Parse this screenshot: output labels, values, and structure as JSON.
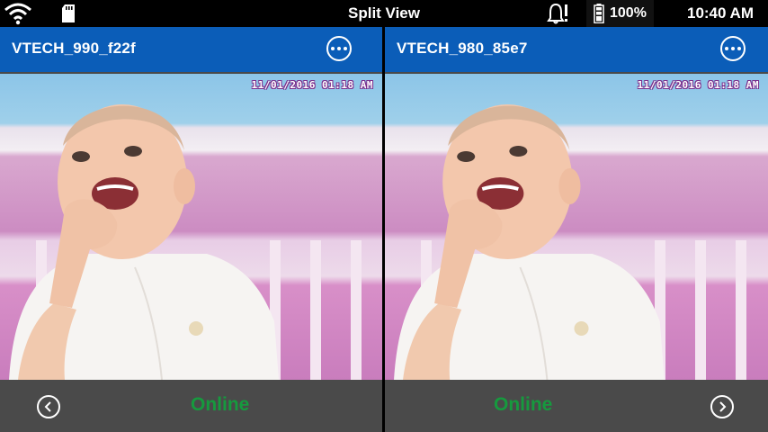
{
  "status_bar": {
    "title": "Split View",
    "battery": "100%",
    "time": "10:40 AM",
    "icons": [
      "wifi-icon",
      "sd-card-icon",
      "alert-bell-icon",
      "battery-icon"
    ]
  },
  "panes": [
    {
      "name": "VTECH_990_f22f",
      "timestamp": "11/01/2016 01:18 AM",
      "status": "Online",
      "nav": "previous"
    },
    {
      "name": "VTECH_980_85e7",
      "timestamp": "11/01/2016 01:18 AM",
      "status": "Online",
      "nav": "next"
    }
  ],
  "colors": {
    "header_blue": "#0b5db8",
    "footer_gray": "#4a4a4a",
    "online_green": "#169a3e"
  }
}
